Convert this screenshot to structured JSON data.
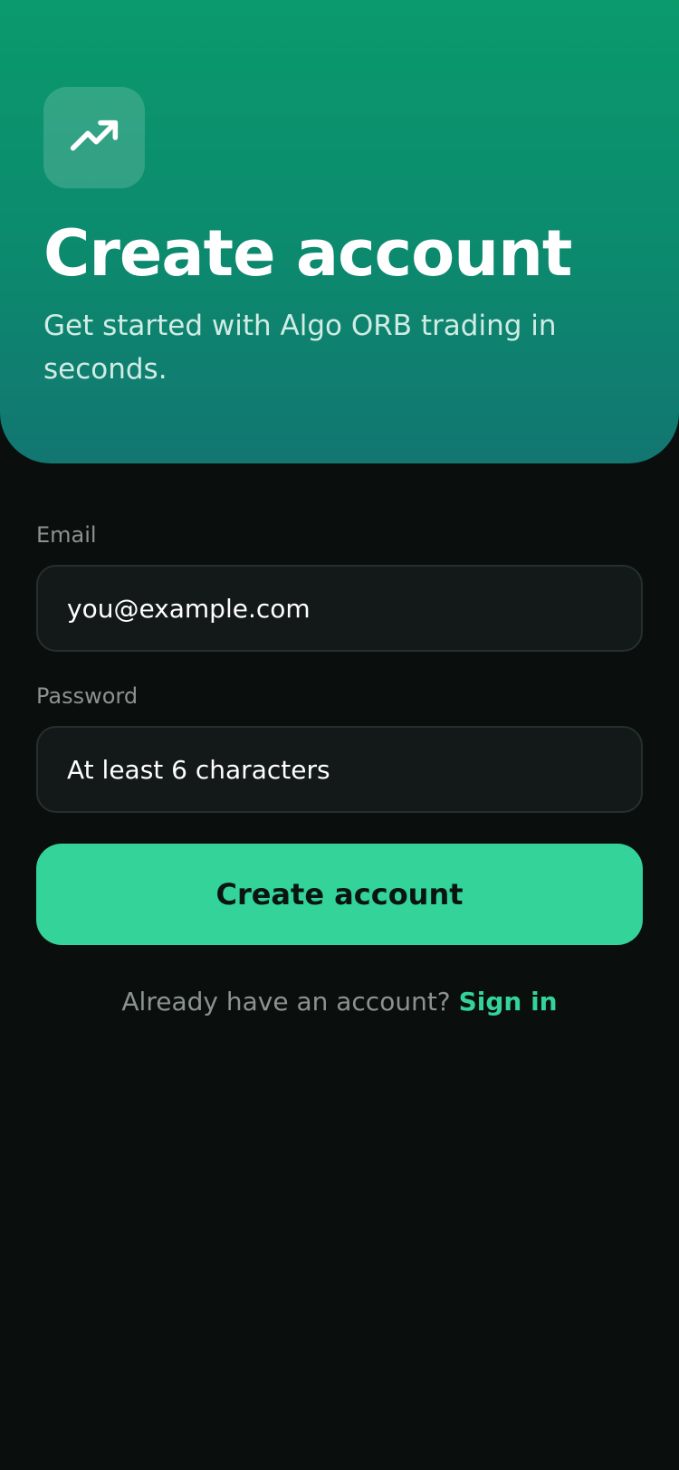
{
  "hero": {
    "icon": "trending-up-icon",
    "title": "Create account",
    "subtitle": "Get started with Algo ORB trading in seconds."
  },
  "form": {
    "email_label": "Email",
    "email_placeholder": "you@example.com",
    "password_label": "Password",
    "password_placeholder": "At least 6 characters",
    "submit_label": "Create account"
  },
  "footer": {
    "prompt": "Already have an account?",
    "link_label": "Sign in"
  },
  "colors": {
    "accent": "#33d399",
    "hero_gradient_top": "#0a9a6c",
    "hero_gradient_bottom": "#127671",
    "background": "#0a0f0e",
    "field_background": "#121918"
  }
}
